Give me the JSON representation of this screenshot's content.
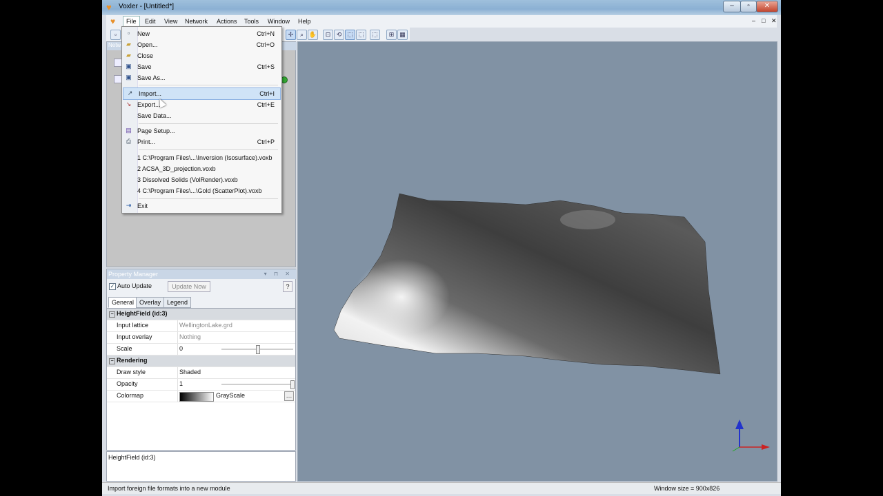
{
  "window": {
    "title": "Voxler - [Untitled*]",
    "app_icon": "voxler-heart-icon",
    "controls": [
      "minimize",
      "maximize",
      "close"
    ]
  },
  "menubar": {
    "items": [
      "File",
      "Edit",
      "View",
      "Network",
      "Actions",
      "Tools",
      "Window",
      "Help"
    ],
    "mdi_controls": [
      "–",
      "□",
      "✕"
    ]
  },
  "file_menu": {
    "items": [
      {
        "icon": "new-file-icon",
        "label": "New",
        "shortcut": "Ctrl+N"
      },
      {
        "icon": "open-folder-icon",
        "label": "Open...",
        "shortcut": "Ctrl+O"
      },
      {
        "icon": "close-folder-icon",
        "label": "Close",
        "shortcut": ""
      },
      {
        "icon": "save-disk-icon",
        "label": "Save",
        "shortcut": "Ctrl+S"
      },
      {
        "icon": "save-as-icon",
        "label": "Save As...",
        "shortcut": ""
      },
      {
        "icon": "import-icon",
        "label": "Import...",
        "shortcut": "Ctrl+I",
        "highlighted": true
      },
      {
        "icon": "export-icon",
        "label": "Export...",
        "shortcut": "Ctrl+E"
      },
      {
        "icon": "",
        "label": "Save Data...",
        "shortcut": ""
      },
      {
        "icon": "page-setup-icon",
        "label": "Page Setup...",
        "shortcut": ""
      },
      {
        "icon": "printer-icon",
        "label": "Print...",
        "shortcut": "Ctrl+P"
      }
    ],
    "recent_files": [
      "1 C:\\Program Files\\...\\Inversion (Isosurface).voxb",
      "2 ACSA_3D_projection.voxb",
      "3 Dissolved Solids (VolRender).voxb",
      "4 C:\\Program Files\\...\\Gold (ScatterPlot).voxb"
    ],
    "exit": {
      "icon": "exit-icon",
      "label": "Exit"
    }
  },
  "network_panel": {
    "title": "Netw"
  },
  "property_manager": {
    "title": "Property Manager",
    "auto_update_label": "Auto Update",
    "auto_update_checked": true,
    "update_now_label": "Update Now",
    "help_label": "?",
    "tabs": [
      "General",
      "Overlay",
      "Legend"
    ],
    "selected_tab": "General",
    "sections": [
      {
        "title": "HeightField (id:3)",
        "rows": [
          {
            "name": "Input lattice",
            "value": "WellingtonLake.grd"
          },
          {
            "name": "Input overlay",
            "value": "Nothing"
          },
          {
            "name": "Scale",
            "value": "0",
            "slider": 0.5
          }
        ]
      },
      {
        "title": "Rendering",
        "rows": [
          {
            "name": "Draw style",
            "value": "Shaded"
          },
          {
            "name": "Opacity",
            "value": "1",
            "slider": 1.0
          },
          {
            "name": "Colormap",
            "value": "GrayScale"
          }
        ]
      }
    ],
    "info_title": "HeightField (id:3)"
  },
  "status_bar": {
    "message": "Import foreign file formats into a new module",
    "window_size": "Window size = 900x826"
  },
  "colors": {
    "viewport_bg": "#8192a4",
    "menu_highlight": "#cfe3f7",
    "panel_header": "#c9d6e6"
  }
}
